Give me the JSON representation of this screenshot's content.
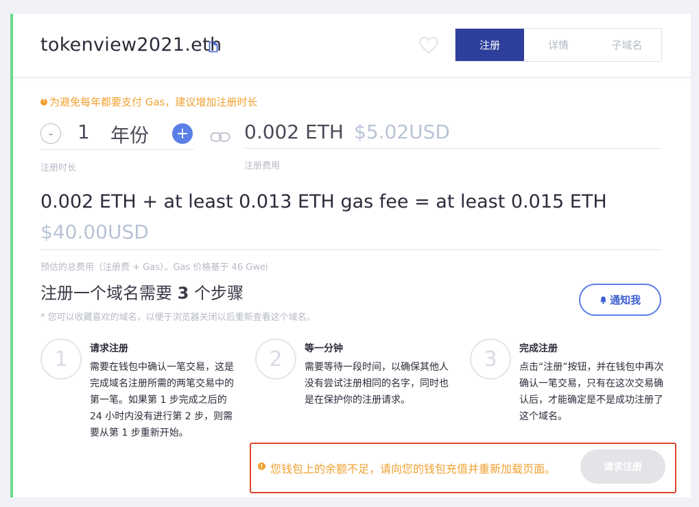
{
  "header": {
    "domain": "tokenview2021.eth",
    "tabs": [
      {
        "label": "注册",
        "active": true
      },
      {
        "label": "详情",
        "active": false
      },
      {
        "label": "子域名",
        "active": false
      }
    ]
  },
  "warning_top": "为避免每年都要支付 Gas，建议增加注册时长",
  "duration": {
    "minus": "-",
    "value": "1",
    "unit": "年份",
    "plus": "+",
    "label": "注册时长"
  },
  "fee": {
    "eth": "0.002 ETH",
    "usd": "$5.02USD",
    "label": "注册费用"
  },
  "total": {
    "line": "0.002 ETH + at least 0.013 ETH gas fee = at least 0.015 ETH",
    "usd": "$40.00USD",
    "note": "预估的总费用（注册费 + Gas）。Gas 价格基于 46 Gwei"
  },
  "steps_header": {
    "prefix": "注册一个域名需要",
    "count": "3",
    "suffix": "个步骤",
    "subtitle": "* 您可以收藏喜欢的域名，以便于浏览器关闭以后重新查看这个域名。"
  },
  "notify_label": "通知我",
  "steps": [
    {
      "number": "1",
      "title": "请求注册",
      "desc": "需要在钱包中确认一笔交易，这是完成域名注册所需的两笔交易中的第一笔。如果第 1 步完成之后的 24 小时内没有进行第 2 步，则需要从第 1 步重新开始。"
    },
    {
      "number": "2",
      "title": "等一分钟",
      "desc": "需要等待一段时间，以确保其他人没有尝试注册相同的名字，同时也是在保护你的注册请求。"
    },
    {
      "number": "3",
      "title": "完成注册",
      "desc": "点击“注册”按钮，并在钱包中再次确认一笔交易，只有在这次交易确认后，才能确定是不是成功注册了这个域名。"
    }
  ],
  "alert": {
    "text": "您钱包上的余额不足，请向您的钱包充值并重新加载页面。",
    "button": "请求注册"
  },
  "colors": {
    "accent": "#2e3f9b",
    "blue": "#5a7fe6",
    "warning": "#f0a030",
    "alert_border": "#e0452a",
    "green_bar": "#6cd98a"
  }
}
